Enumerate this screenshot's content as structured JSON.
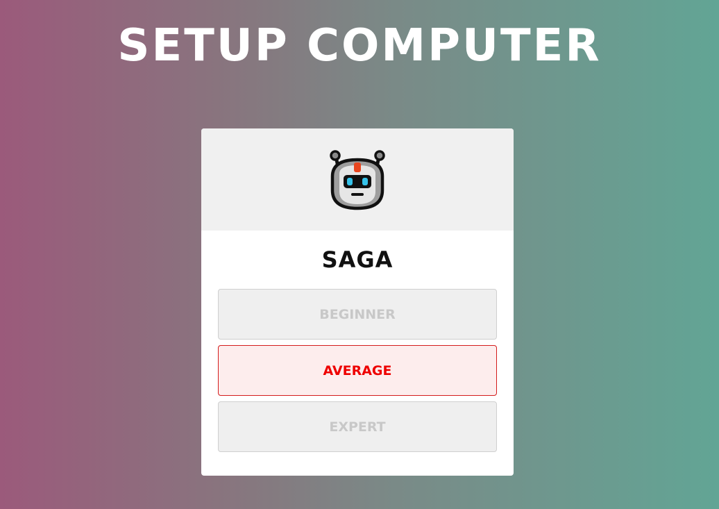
{
  "page": {
    "title": "SETUP COMPUTER"
  },
  "opponent": {
    "avatar_icon": "robot-icon",
    "name": "SAGA"
  },
  "difficulty": {
    "selected": "AVERAGE",
    "options": [
      {
        "label": "BEGINNER"
      },
      {
        "label": "AVERAGE"
      },
      {
        "label": "EXPERT"
      }
    ]
  },
  "colors": {
    "selected_text": "#ee0000",
    "selected_border": "#d41b1b",
    "selected_bg": "#fdeded",
    "unselected_text": "#c8c8c8",
    "unselected_bg": "#efefef"
  }
}
